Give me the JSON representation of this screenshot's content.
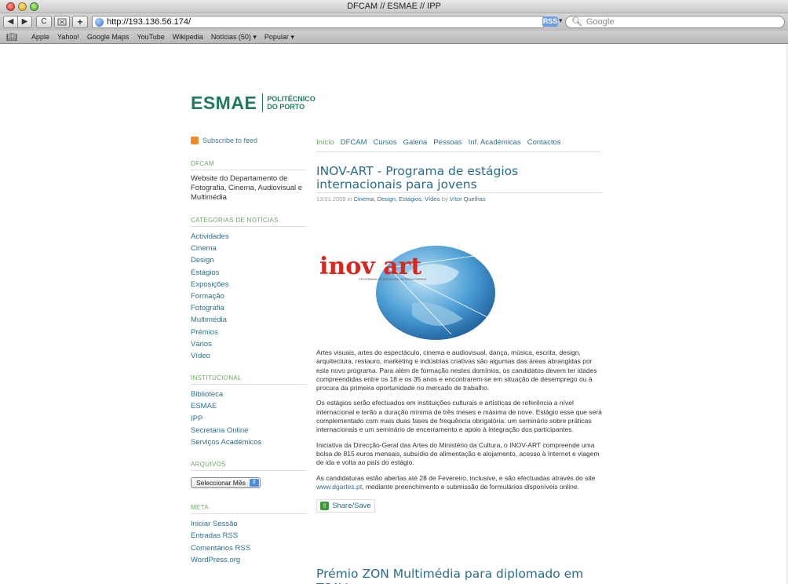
{
  "window": {
    "title": "DFCAM // ESMAE // IPP"
  },
  "toolbar": {
    "back": "◀",
    "forward": "▶",
    "reload": "C",
    "add": "+",
    "url": "http://193.136.56.174/",
    "rss": "RSS",
    "search_placeholder": "Google"
  },
  "bookmarks": {
    "items": [
      "Apple",
      "Yahoo!",
      "Google Maps",
      "YouTube",
      "Wikipedia",
      "Notícias (50) ▾",
      "Popular ▾"
    ]
  },
  "logo": {
    "main": "ESMAE",
    "sub1": "POLITÉCNICO",
    "sub2": "DO PORTO"
  },
  "sidebar": {
    "feed": "Subscribe to feed",
    "dfcam_head": "DFCAM",
    "dfcam_desc": "Website do Departamento de Fotografia, Cinema, Audiovisual e Multimédia",
    "categorias_head": "CATEGORIAS DE NOTÍCIAS",
    "categorias": [
      "Actividades",
      "Cinema",
      "Design",
      "Estágios",
      "Exposições",
      "Formação",
      "Fotografia",
      "Multimédia",
      "Prémios",
      "Vários",
      "Vídeo"
    ],
    "institucional_head": "INSTITUCIONAL",
    "institucional": [
      "Biblioteca",
      "ESMAE",
      "IPP",
      "Secretaria Online",
      "Serviços Académicos"
    ],
    "arquivos_head": "ARQUIVOS",
    "arquivos_select": "Seleccionar Mês",
    "meta_head": "META",
    "meta": [
      "Iniciar Sessão",
      "Entradas RSS",
      "Comentários RSS",
      "WordPress.org"
    ]
  },
  "nav": [
    "Início",
    "DFCAM",
    "Cursos",
    "Galeria",
    "Pessoas",
    "Inf. Académicas",
    "Contactos"
  ],
  "post": {
    "title": "INOV-ART - Programa de estágios internacionais para jovens",
    "date": "13.01.2009 in",
    "categories": "Cinema, Design, Estágios, Vídeo",
    "by": "by",
    "author": "Vítor Quelhas",
    "logo_word": "inov art",
    "logo_sub": "PROGRAMA DE ESTÁGIOS INTERNACIONAIS",
    "p1": "Artes visuais, artes do espectáculo, cinema e audiovisual, dança, música, escrita, design, arquitectura, restauro, marketing e indústrias criativas são algumas das áreas abrangidas por este novo programa. Para além de formação nestes domínios, os candidatos devem ter idades compreendidas entre os 18 e os 35 anos e encontrarem-se em situação de desemprego ou à procura da primeira oportunidade no mercado de trabalho.",
    "p2": "Os estágios serão efectuados em instituições culturais e artísticas de referência a nível internacional e terão a duração mínima de três meses e máxima de nove. Estágio esse que será complementado com mais duas fases de frequência obrigatória: um seminário sobre práticas internacionais e um seminário de encerramento e apoio à integração dos participantes.",
    "p3": "Iniciativa da Direcção-Geral das Artes do Ministério da Cultura, o INOV-ART compreende uma bolsa de 815 euros mensais, subsídio de alimentação e alojamento, acesso à Internet e viagem de ida e volta ao país do estágio.",
    "p4_pre": "As candidaturas estão abertas até 28 de Fevereiro, inclusive, e são efectuadas através do site",
    "p4_link": "www.dgartes.pt",
    "p4_post": ", mediante preenchimento e submissão de formulários disponíveis online.",
    "share": "Share/Save"
  },
  "post2": {
    "title": "Prémio ZON Multimédia para diplomado em TCAV"
  }
}
